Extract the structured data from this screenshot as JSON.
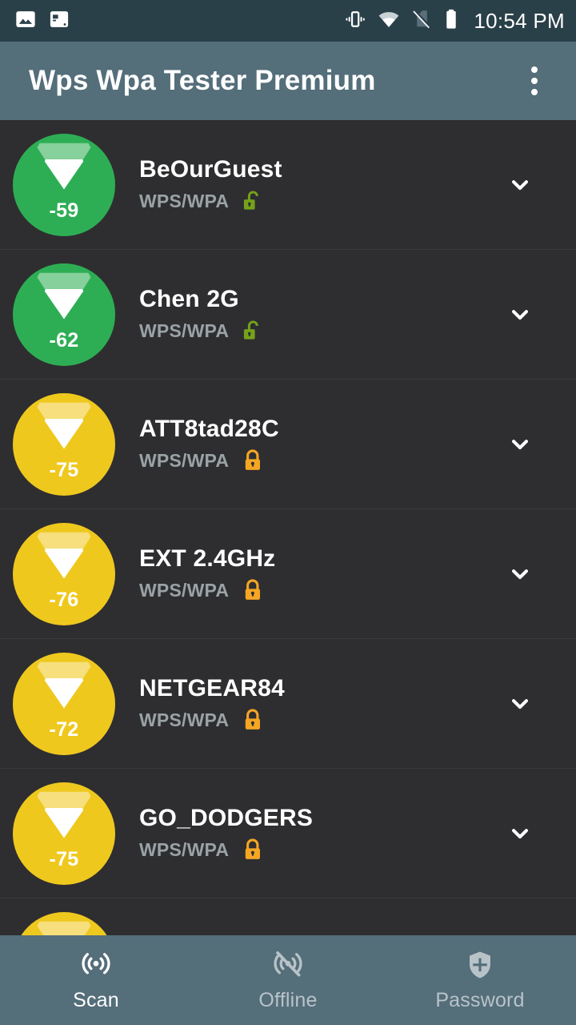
{
  "status_bar": {
    "background": "#2a4049",
    "clock": "10:54 PM",
    "left_icons": [
      {
        "name": "image-icon",
        "label": "Screenshot"
      },
      {
        "name": "terminal-icon",
        "label": "Terminal"
      }
    ],
    "right_icons": [
      {
        "name": "vibrate-icon",
        "label": "Vibrate"
      },
      {
        "name": "wifi-icon",
        "label": "Wi-Fi connected"
      },
      {
        "name": "no-sim-icon",
        "label": "No SIM"
      },
      {
        "name": "battery-icon",
        "label": "Battery full"
      }
    ]
  },
  "app_bar": {
    "title": "Wps Wpa Tester Premium",
    "background": "#546e7a",
    "overflow_label": "More options"
  },
  "colors": {
    "list_background": "#2e2e30",
    "divider": "#3a3a3c",
    "signal_good": "#2eae54",
    "signal_medium": "#efc81e",
    "lock_open": "#76a21a",
    "lock_closed": "#f5a623",
    "secondary_text": "#9aa2a6"
  },
  "networks": [
    {
      "ssid": "BeOurGuest",
      "security": "WPS/WPA",
      "rssi": "-59",
      "signal_level": "good",
      "lock_state": "open",
      "expand_label": "Expand"
    },
    {
      "ssid": "Chen 2G",
      "security": "WPS/WPA",
      "rssi": "-62",
      "signal_level": "good",
      "lock_state": "open",
      "expand_label": "Expand"
    },
    {
      "ssid": "ATT8tad28C",
      "security": "WPS/WPA",
      "rssi": "-75",
      "signal_level": "medium",
      "lock_state": "closed",
      "expand_label": "Expand"
    },
    {
      "ssid": "EXT 2.4GHz",
      "security": "WPS/WPA",
      "rssi": "-76",
      "signal_level": "medium",
      "lock_state": "closed",
      "expand_label": "Expand"
    },
    {
      "ssid": "NETGEAR84",
      "security": "WPS/WPA",
      "rssi": "-72",
      "signal_level": "medium",
      "lock_state": "closed",
      "expand_label": "Expand"
    },
    {
      "ssid": "GO_DODGERS",
      "security": "WPS/WPA",
      "rssi": "-75",
      "signal_level": "medium",
      "lock_state": "closed",
      "expand_label": "Expand"
    },
    {
      "ssid": "",
      "security": "",
      "rssi": "",
      "signal_level": "medium",
      "lock_state": "closed",
      "expand_label": "Expand",
      "partial": true
    }
  ],
  "bottom_nav": {
    "background": "#546e7a",
    "items": [
      {
        "label": "Scan",
        "icon": "radar-scan-icon",
        "active": true
      },
      {
        "label": "Offline",
        "icon": "radar-off-icon",
        "active": false
      },
      {
        "label": "Password",
        "icon": "shield-icon",
        "active": false
      }
    ]
  }
}
